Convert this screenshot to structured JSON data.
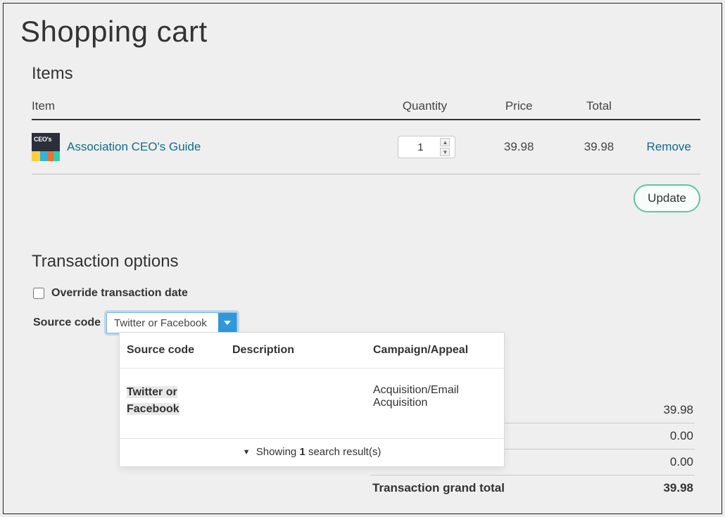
{
  "page": {
    "title": "Shopping cart"
  },
  "sections": {
    "items_title": "Items",
    "transaction_title": "Transaction options"
  },
  "table": {
    "headers": {
      "item": "Item",
      "quantity": "Quantity",
      "price": "Price",
      "total": "Total"
    },
    "rows": [
      {
        "name": "Association CEO's Guide",
        "quantity": "1",
        "price": "39.98",
        "total": "39.98",
        "remove_label": "Remove"
      }
    ]
  },
  "buttons": {
    "update": "Update"
  },
  "options": {
    "override_label": "Override transaction date",
    "source_code_label": "Source code",
    "source_code_value": "Twitter or Facebook"
  },
  "dropdown": {
    "headers": {
      "source_code": "Source code",
      "description": "Description",
      "campaign": "Campaign/Appeal"
    },
    "rows": [
      {
        "source_code": "Twitter or Facebook",
        "description": "",
        "campaign": "Acquisition/Email Acquisition"
      }
    ],
    "footer_prefix": "Showing ",
    "footer_count": "1",
    "footer_suffix": " search result(s)"
  },
  "totals": {
    "lines": [
      {
        "label": "",
        "value": "39.98"
      },
      {
        "label": "",
        "value": "0.00"
      },
      {
        "label": "",
        "value": "0.00"
      }
    ],
    "grand": {
      "label": "Transaction grand total",
      "value": "39.98"
    }
  }
}
